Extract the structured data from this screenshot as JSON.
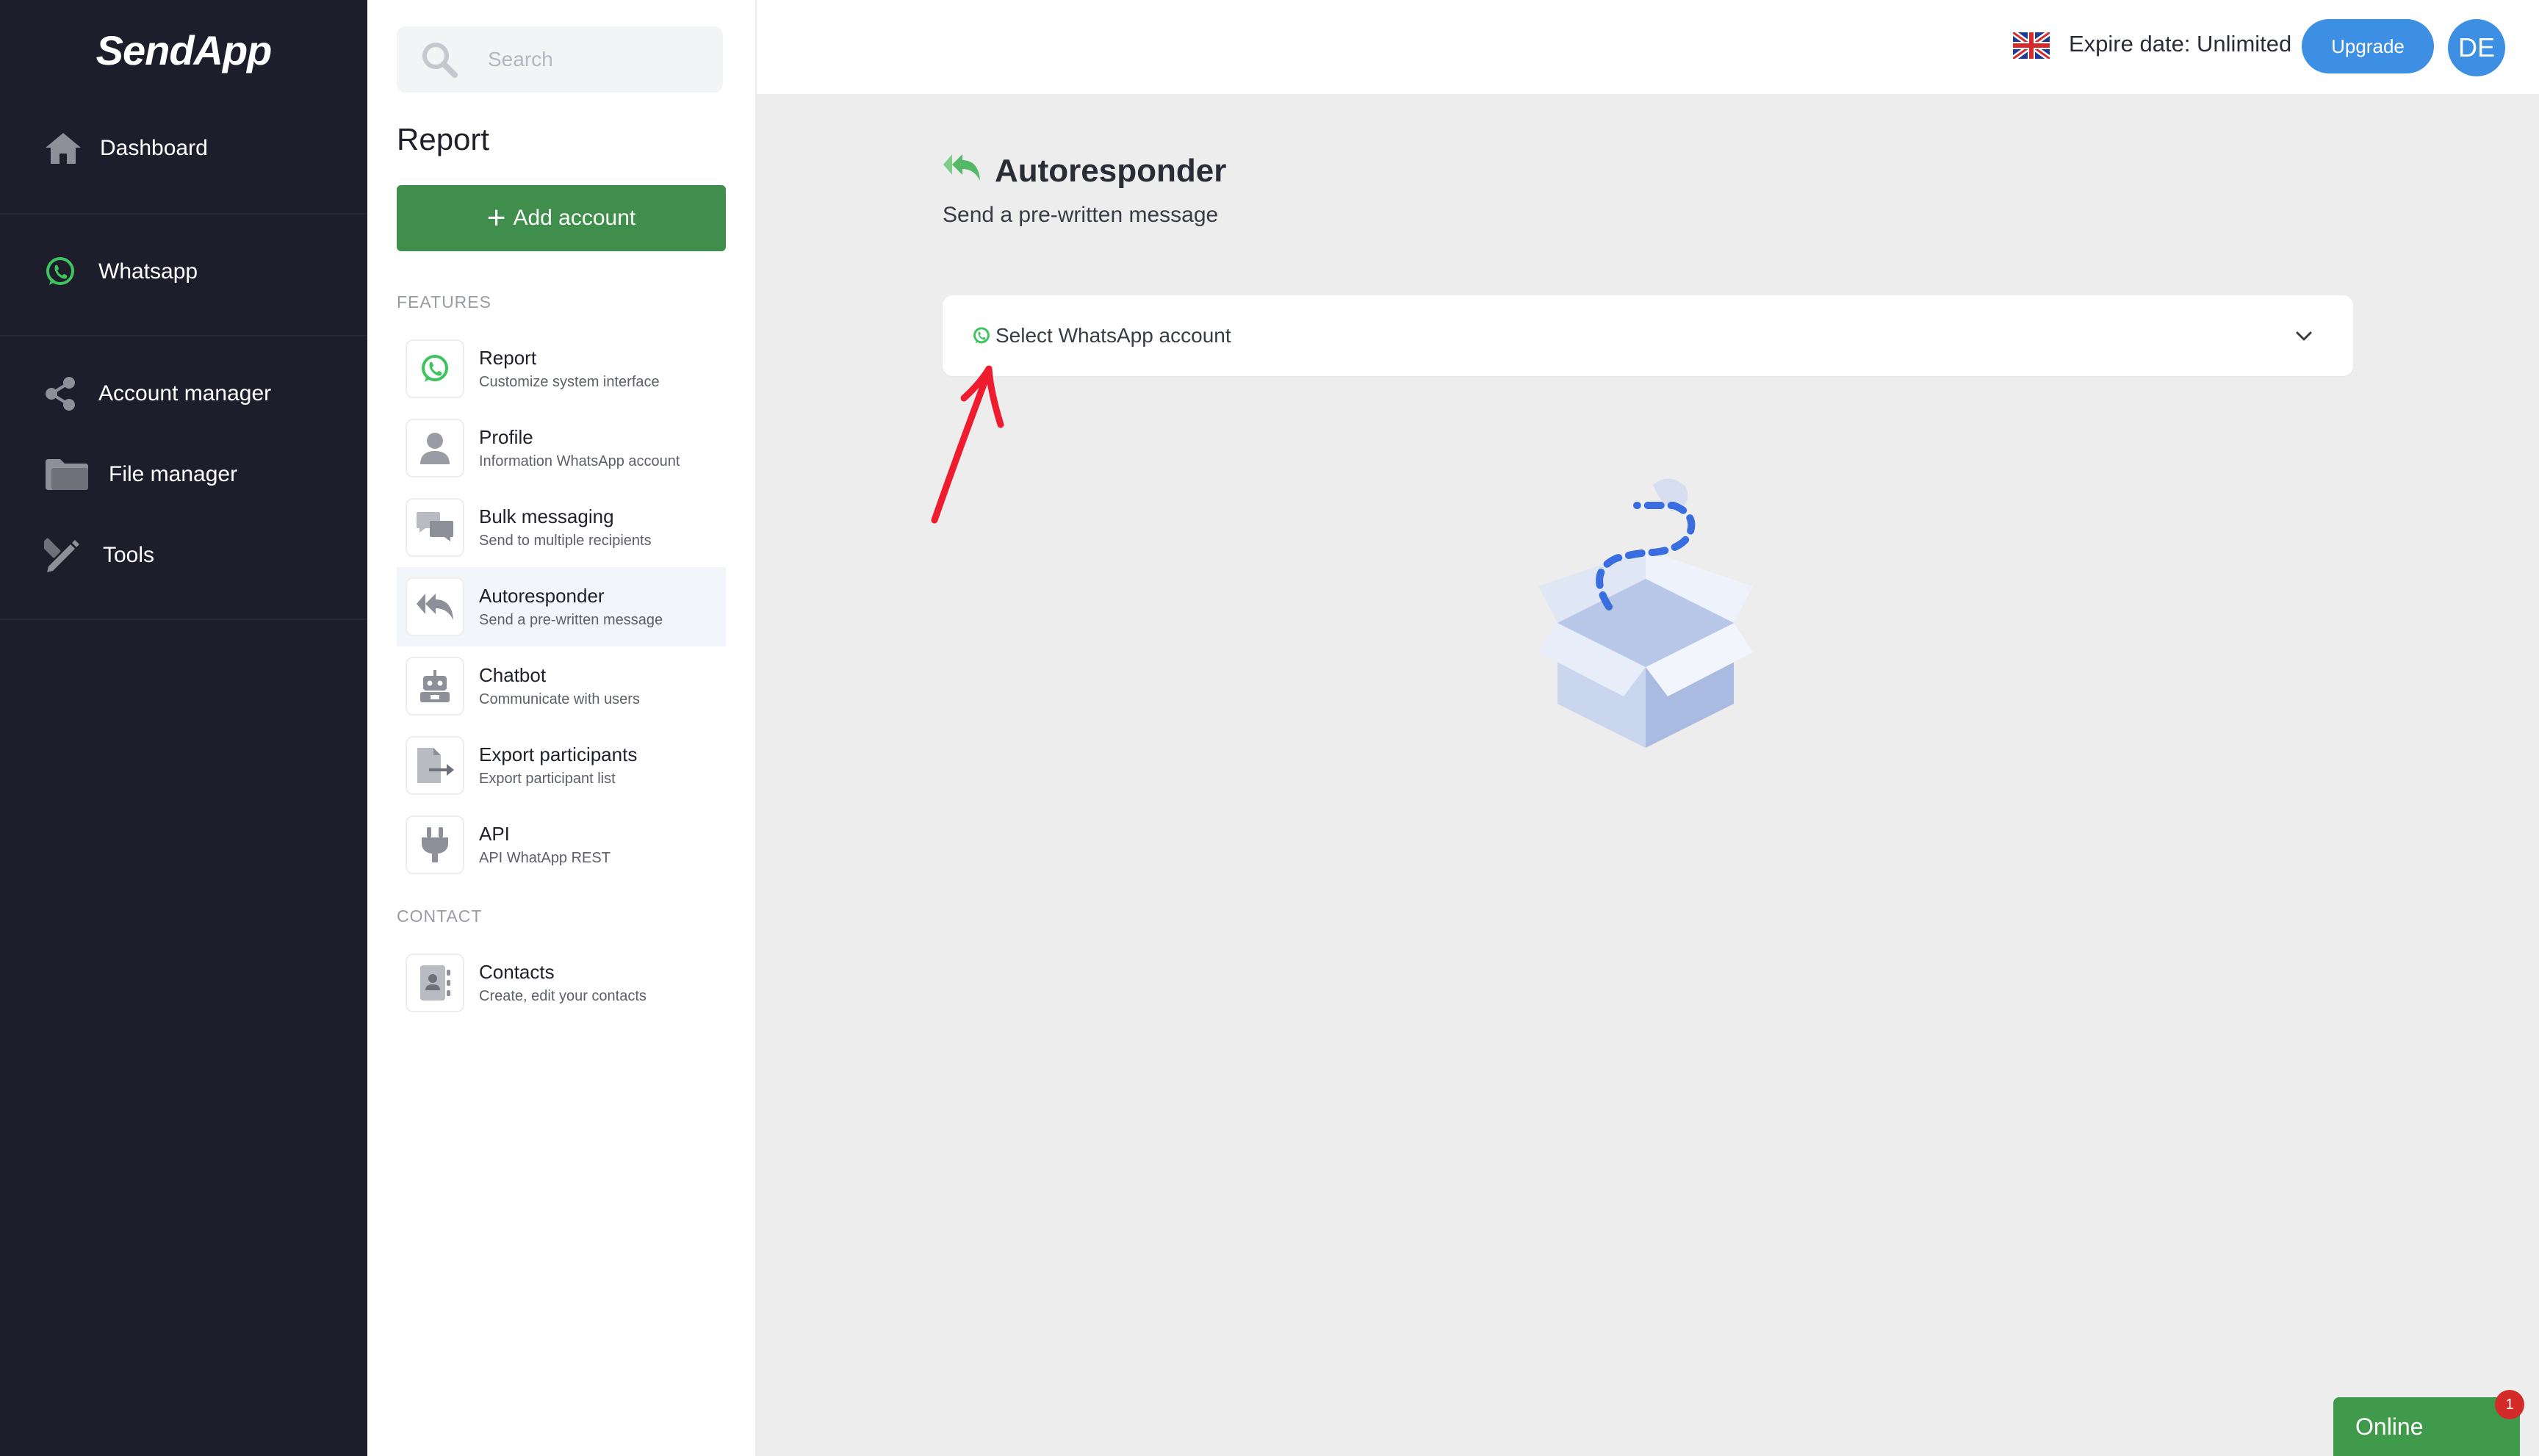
{
  "sidebar": {
    "logo": "SendApp",
    "items": [
      {
        "label": "Dashboard",
        "icon": "home-icon"
      },
      {
        "label": "Whatsapp",
        "icon": "whatsapp-icon"
      },
      {
        "label": "Account manager",
        "icon": "share-nodes-icon"
      },
      {
        "label": "File manager",
        "icon": "folder-icon"
      },
      {
        "label": "Tools",
        "icon": "pencil-ruler-icon"
      }
    ]
  },
  "panel": {
    "search_placeholder": "Search",
    "title": "Report",
    "add_account_label": "Add account",
    "sections": {
      "features": "FEATURES",
      "contact": "CONTACT"
    },
    "features": [
      {
        "title": "Report",
        "subtitle": "Customize system interface",
        "icon": "whatsapp-icon"
      },
      {
        "title": "Profile",
        "subtitle": "Information WhatsApp account",
        "icon": "user-icon"
      },
      {
        "title": "Bulk messaging",
        "subtitle": "Send to multiple recipients",
        "icon": "chat-bubbles-icon"
      },
      {
        "title": "Autoresponder",
        "subtitle": "Send a pre-written message",
        "icon": "reply-all-icon",
        "active": true
      },
      {
        "title": "Chatbot",
        "subtitle": "Communicate with users",
        "icon": "robot-icon"
      },
      {
        "title": "Export participants",
        "subtitle": "Export participant list",
        "icon": "file-export-icon"
      },
      {
        "title": "API",
        "subtitle": "API WhatApp REST",
        "icon": "plug-icon"
      }
    ],
    "contacts": [
      {
        "title": "Contacts",
        "subtitle": "Create, edit your contacts",
        "icon": "address-book-icon"
      }
    ]
  },
  "header": {
    "expire_text": "Expire date: Unlimited",
    "upgrade_label": "Upgrade",
    "avatar_initials": "DE"
  },
  "main": {
    "title": "Autoresponder",
    "subtitle": "Send a pre-written message",
    "select_label": "Select WhatsApp account"
  },
  "online_widget": {
    "label": "Online",
    "badge": "1"
  },
  "colors": {
    "sidebar_bg": "#1d1d2c",
    "accent_green": "#3f8e4b",
    "accent_blue": "#3d8fe4",
    "annotation_red": "#ee1c2e"
  }
}
